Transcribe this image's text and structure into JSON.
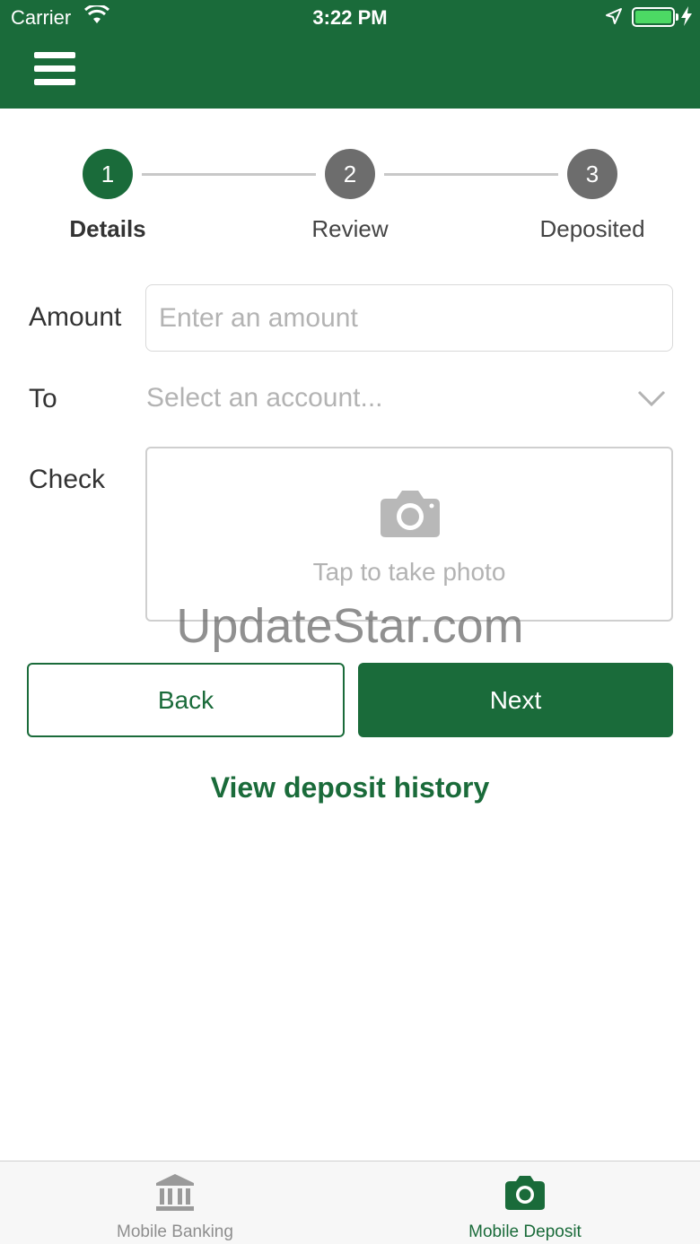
{
  "status_bar": {
    "carrier": "Carrier",
    "time": "3:22 PM"
  },
  "header": {
    "menu_icon": "hamburger-menu-icon"
  },
  "stepper": {
    "steps": [
      {
        "number": "1",
        "label": "Details",
        "state": "active"
      },
      {
        "number": "2",
        "label": "Review",
        "state": "inactive"
      },
      {
        "number": "3",
        "label": "Deposited",
        "state": "inactive"
      }
    ]
  },
  "form": {
    "amount_label": "Amount",
    "amount_placeholder": "Enter an amount",
    "amount_value": "",
    "to_label": "To",
    "to_placeholder": "Select an account...",
    "check_label": "Check",
    "check_caption": "Tap to take photo"
  },
  "watermark": "UpdateStar.com",
  "buttons": {
    "back": "Back",
    "next": "Next"
  },
  "history_link": "View deposit history",
  "tabbar": {
    "tabs": [
      {
        "label": "Mobile Banking",
        "icon": "bank-icon",
        "active": false
      },
      {
        "label": "Mobile Deposit",
        "icon": "camera-icon",
        "active": true
      }
    ]
  },
  "colors": {
    "brand_green": "#1a6b3a",
    "inactive_step": "#6d6d6d",
    "placeholder": "#b3b3b3",
    "battery": "#4cd964"
  }
}
